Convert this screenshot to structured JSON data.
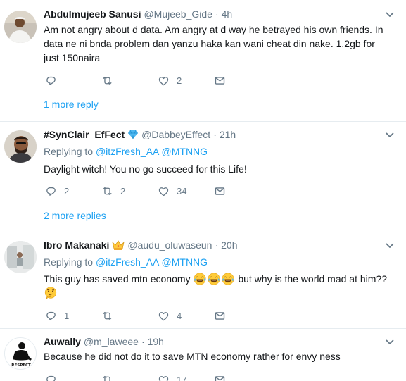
{
  "icons": {
    "reply": "reply-icon",
    "retweet": "retweet-icon",
    "like": "heart-icon",
    "dm": "envelope-icon",
    "caret": "chevron-down-icon",
    "verified_badge": "diamond-icon",
    "crown": "crown-icon"
  },
  "colors": {
    "accent": "#1da1f2",
    "muted": "#657786",
    "divider": "#e6ecf0"
  },
  "tweets": [
    {
      "name": "Abdulmujeeb Sanusi",
      "handle": "@Mujeeb_Gide",
      "dot": "·",
      "time": "4h",
      "text": "Am not angry about d data. Am angry at d way he betrayed his own friends. In data ne ni bnda problem dan yanzu haka kan wani cheat din nake. 1.2gb for just 150naira",
      "counts": {
        "reply": "",
        "retweet": "",
        "like": "2"
      },
      "more_replies": "1 more reply"
    },
    {
      "name": "#SynClair_EfFect",
      "handle": "@DabbeyEffect",
      "dot": "·",
      "time": "21h",
      "replying_prefix": "Replying to",
      "mention1": "@itzFresh_AA",
      "mention2": "@MTNNG",
      "text": "Daylight witch! You no go succeed for this Life!",
      "counts": {
        "reply": "2",
        "retweet": "2",
        "like": "34"
      },
      "more_replies": "2 more replies"
    },
    {
      "name": "Ibro Makanaki",
      "handle": "@audu_oluwaseun",
      "dot": "·",
      "time": "20h",
      "replying_prefix": "Replying to",
      "mention1": "@itzFresh_AA",
      "mention2": "@MTNNG",
      "text_before": "This guy has saved mtn economy",
      "text_after": "but why is the world mad at him??",
      "counts": {
        "reply": "1",
        "retweet": "",
        "like": "4"
      }
    },
    {
      "name": "Auwally",
      "handle": "@m_laweee",
      "dot": "·",
      "time": "19h",
      "avatar_text": "RESPECT",
      "text": "Because he did not do it to save MTN economy rather for envy ness",
      "counts": {
        "reply": "",
        "retweet": "",
        "like": "17"
      }
    }
  ]
}
